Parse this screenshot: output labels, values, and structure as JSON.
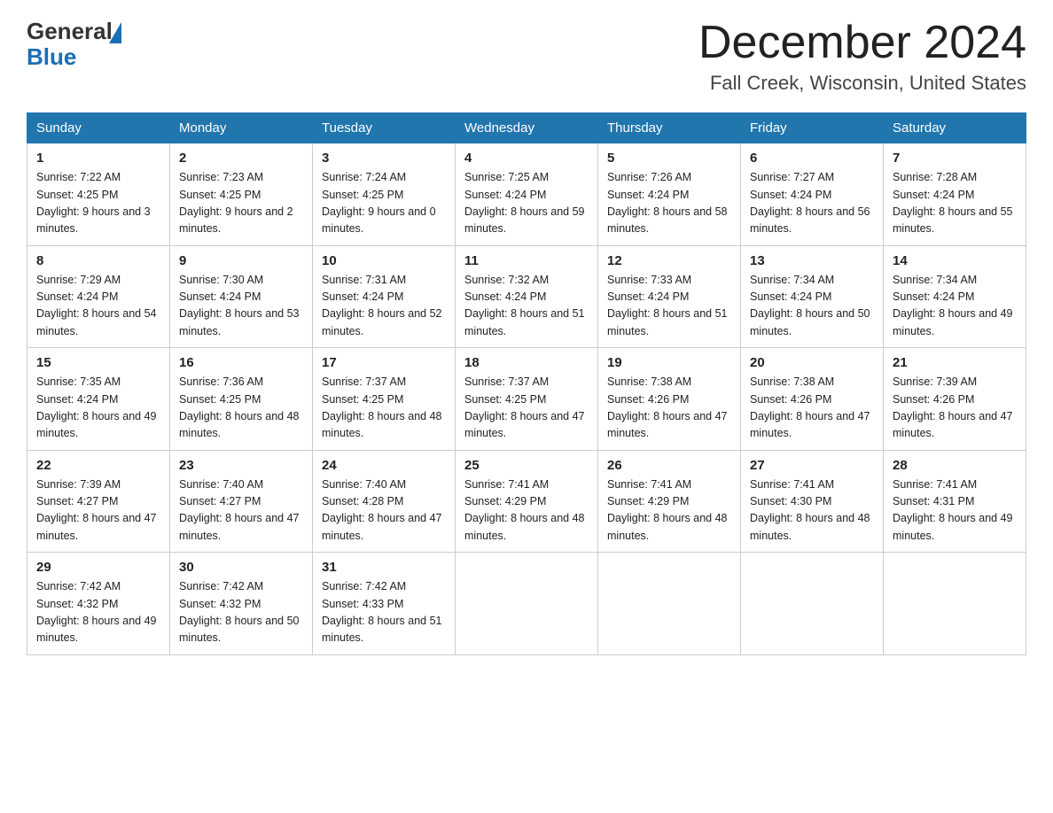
{
  "header": {
    "logo_general": "General",
    "logo_blue": "Blue",
    "month_title": "December 2024",
    "location": "Fall Creek, Wisconsin, United States"
  },
  "days_of_week": [
    "Sunday",
    "Monday",
    "Tuesday",
    "Wednesday",
    "Thursday",
    "Friday",
    "Saturday"
  ],
  "weeks": [
    [
      {
        "day": "1",
        "sunrise": "7:22 AM",
        "sunset": "4:25 PM",
        "daylight": "9 hours and 3 minutes."
      },
      {
        "day": "2",
        "sunrise": "7:23 AM",
        "sunset": "4:25 PM",
        "daylight": "9 hours and 2 minutes."
      },
      {
        "day": "3",
        "sunrise": "7:24 AM",
        "sunset": "4:25 PM",
        "daylight": "9 hours and 0 minutes."
      },
      {
        "day": "4",
        "sunrise": "7:25 AM",
        "sunset": "4:24 PM",
        "daylight": "8 hours and 59 minutes."
      },
      {
        "day": "5",
        "sunrise": "7:26 AM",
        "sunset": "4:24 PM",
        "daylight": "8 hours and 58 minutes."
      },
      {
        "day": "6",
        "sunrise": "7:27 AM",
        "sunset": "4:24 PM",
        "daylight": "8 hours and 56 minutes."
      },
      {
        "day": "7",
        "sunrise": "7:28 AM",
        "sunset": "4:24 PM",
        "daylight": "8 hours and 55 minutes."
      }
    ],
    [
      {
        "day": "8",
        "sunrise": "7:29 AM",
        "sunset": "4:24 PM",
        "daylight": "8 hours and 54 minutes."
      },
      {
        "day": "9",
        "sunrise": "7:30 AM",
        "sunset": "4:24 PM",
        "daylight": "8 hours and 53 minutes."
      },
      {
        "day": "10",
        "sunrise": "7:31 AM",
        "sunset": "4:24 PM",
        "daylight": "8 hours and 52 minutes."
      },
      {
        "day": "11",
        "sunrise": "7:32 AM",
        "sunset": "4:24 PM",
        "daylight": "8 hours and 51 minutes."
      },
      {
        "day": "12",
        "sunrise": "7:33 AM",
        "sunset": "4:24 PM",
        "daylight": "8 hours and 51 minutes."
      },
      {
        "day": "13",
        "sunrise": "7:34 AM",
        "sunset": "4:24 PM",
        "daylight": "8 hours and 50 minutes."
      },
      {
        "day": "14",
        "sunrise": "7:34 AM",
        "sunset": "4:24 PM",
        "daylight": "8 hours and 49 minutes."
      }
    ],
    [
      {
        "day": "15",
        "sunrise": "7:35 AM",
        "sunset": "4:24 PM",
        "daylight": "8 hours and 49 minutes."
      },
      {
        "day": "16",
        "sunrise": "7:36 AM",
        "sunset": "4:25 PM",
        "daylight": "8 hours and 48 minutes."
      },
      {
        "day": "17",
        "sunrise": "7:37 AM",
        "sunset": "4:25 PM",
        "daylight": "8 hours and 48 minutes."
      },
      {
        "day": "18",
        "sunrise": "7:37 AM",
        "sunset": "4:25 PM",
        "daylight": "8 hours and 47 minutes."
      },
      {
        "day": "19",
        "sunrise": "7:38 AM",
        "sunset": "4:26 PM",
        "daylight": "8 hours and 47 minutes."
      },
      {
        "day": "20",
        "sunrise": "7:38 AM",
        "sunset": "4:26 PM",
        "daylight": "8 hours and 47 minutes."
      },
      {
        "day": "21",
        "sunrise": "7:39 AM",
        "sunset": "4:26 PM",
        "daylight": "8 hours and 47 minutes."
      }
    ],
    [
      {
        "day": "22",
        "sunrise": "7:39 AM",
        "sunset": "4:27 PM",
        "daylight": "8 hours and 47 minutes."
      },
      {
        "day": "23",
        "sunrise": "7:40 AM",
        "sunset": "4:27 PM",
        "daylight": "8 hours and 47 minutes."
      },
      {
        "day": "24",
        "sunrise": "7:40 AM",
        "sunset": "4:28 PM",
        "daylight": "8 hours and 47 minutes."
      },
      {
        "day": "25",
        "sunrise": "7:41 AM",
        "sunset": "4:29 PM",
        "daylight": "8 hours and 48 minutes."
      },
      {
        "day": "26",
        "sunrise": "7:41 AM",
        "sunset": "4:29 PM",
        "daylight": "8 hours and 48 minutes."
      },
      {
        "day": "27",
        "sunrise": "7:41 AM",
        "sunset": "4:30 PM",
        "daylight": "8 hours and 48 minutes."
      },
      {
        "day": "28",
        "sunrise": "7:41 AM",
        "sunset": "4:31 PM",
        "daylight": "8 hours and 49 minutes."
      }
    ],
    [
      {
        "day": "29",
        "sunrise": "7:42 AM",
        "sunset": "4:32 PM",
        "daylight": "8 hours and 49 minutes."
      },
      {
        "day": "30",
        "sunrise": "7:42 AM",
        "sunset": "4:32 PM",
        "daylight": "8 hours and 50 minutes."
      },
      {
        "day": "31",
        "sunrise": "7:42 AM",
        "sunset": "4:33 PM",
        "daylight": "8 hours and 51 minutes."
      },
      null,
      null,
      null,
      null
    ]
  ]
}
